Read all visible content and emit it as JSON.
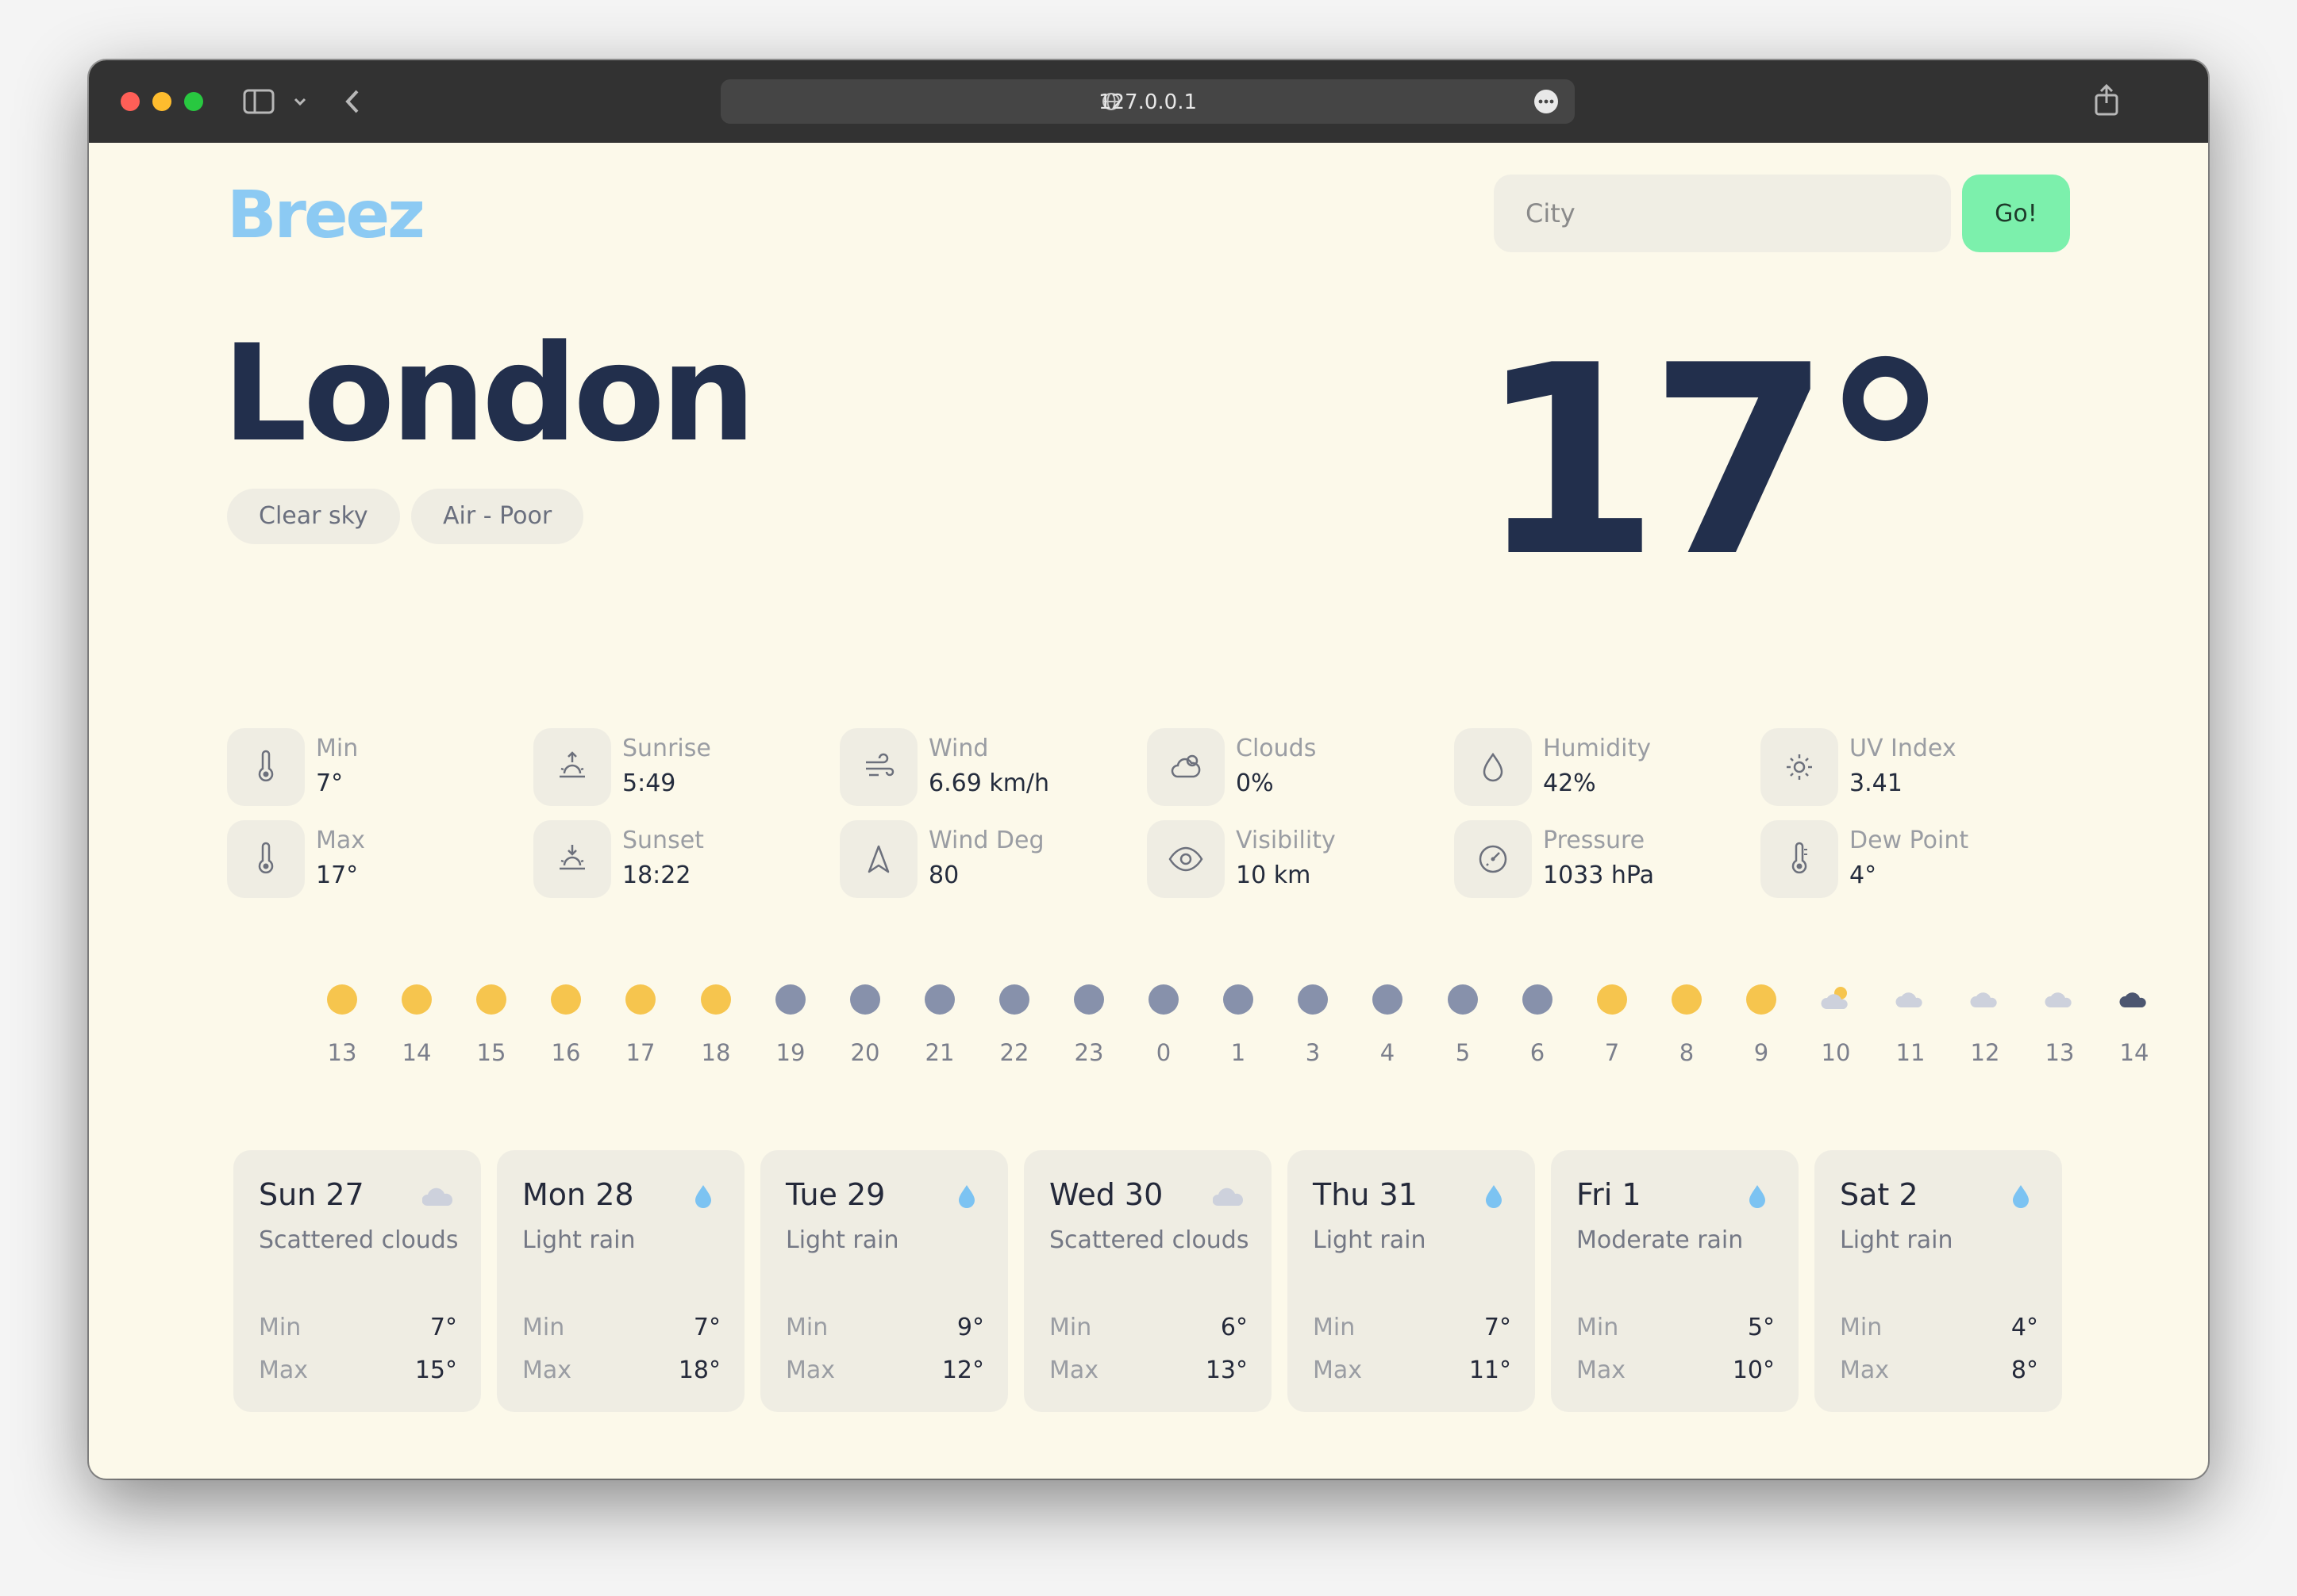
{
  "browser": {
    "url": "127.0.0.1"
  },
  "app": {
    "logo": "Breez"
  },
  "search": {
    "placeholder": "City",
    "button": "Go!"
  },
  "current": {
    "city": "London",
    "temp": "17°",
    "chips": [
      "Clear sky",
      "Air - Poor"
    ]
  },
  "stats": [
    {
      "label": "Min",
      "value": "7°",
      "icon": "thermometer-icon"
    },
    {
      "label": "Sunrise",
      "value": "5:49",
      "icon": "sunrise-icon"
    },
    {
      "label": "Wind",
      "value": "6.69 km/h",
      "icon": "wind-icon"
    },
    {
      "label": "Clouds",
      "value": "0%",
      "icon": "cloud-icon"
    },
    {
      "label": "Humidity",
      "value": "42%",
      "icon": "droplet-icon"
    },
    {
      "label": "UV Index",
      "value": "3.41",
      "icon": "sun-icon"
    },
    {
      "label": "Max",
      "value": "17°",
      "icon": "thermometer-icon"
    },
    {
      "label": "Sunset",
      "value": "18:22",
      "icon": "sunset-icon"
    },
    {
      "label": "Wind Deg",
      "value": "80",
      "icon": "navigation-arrow-icon"
    },
    {
      "label": "Visibility",
      "value": "10 km",
      "icon": "eye-icon"
    },
    {
      "label": "Pressure",
      "value": "1033 hPa",
      "icon": "gauge-icon"
    },
    {
      "label": "Dew Point",
      "value": "4°",
      "icon": "thermometer-icon"
    }
  ],
  "hourly": [
    {
      "hour": "13",
      "icon": "sun"
    },
    {
      "hour": "14",
      "icon": "sun"
    },
    {
      "hour": "15",
      "icon": "sun"
    },
    {
      "hour": "16",
      "icon": "sun"
    },
    {
      "hour": "17",
      "icon": "sun"
    },
    {
      "hour": "18",
      "icon": "sun"
    },
    {
      "hour": "19",
      "icon": "moon"
    },
    {
      "hour": "20",
      "icon": "moon"
    },
    {
      "hour": "21",
      "icon": "moon"
    },
    {
      "hour": "22",
      "icon": "moon"
    },
    {
      "hour": "23",
      "icon": "moon"
    },
    {
      "hour": "0",
      "icon": "moon"
    },
    {
      "hour": "1",
      "icon": "moon"
    },
    {
      "hour": "3",
      "icon": "moon"
    },
    {
      "hour": "4",
      "icon": "moon"
    },
    {
      "hour": "5",
      "icon": "moon"
    },
    {
      "hour": "6",
      "icon": "moon"
    },
    {
      "hour": "7",
      "icon": "sun"
    },
    {
      "hour": "8",
      "icon": "sun"
    },
    {
      "hour": "9",
      "icon": "sun"
    },
    {
      "hour": "10",
      "icon": "partly-cloudy"
    },
    {
      "hour": "11",
      "icon": "cloud"
    },
    {
      "hour": "12",
      "icon": "cloud"
    },
    {
      "hour": "13",
      "icon": "cloud"
    },
    {
      "hour": "14",
      "icon": "dark-cloud"
    }
  ],
  "daily": [
    {
      "day": "Sun 27",
      "desc": "Scattered clouds",
      "icon": "cloud",
      "min": "7°",
      "max": "15°"
    },
    {
      "day": "Mon 28",
      "desc": "Light rain",
      "icon": "rain-drop",
      "min": "7°",
      "max": "18°"
    },
    {
      "day": "Tue 29",
      "desc": "Light rain",
      "icon": "rain-drop",
      "min": "9°",
      "max": "12°"
    },
    {
      "day": "Wed 30",
      "desc": "Scattered clouds",
      "icon": "cloud",
      "min": "6°",
      "max": "13°"
    },
    {
      "day": "Thu 31",
      "desc": "Light rain",
      "icon": "rain-drop",
      "min": "7°",
      "max": "11°"
    },
    {
      "day": "Fri 1",
      "desc": "Moderate rain",
      "icon": "rain-drop",
      "min": "5°",
      "max": "10°"
    },
    {
      "day": "Sat 2",
      "desc": "Light rain",
      "icon": "rain-drop",
      "min": "4°",
      "max": "8°"
    }
  ],
  "labels": {
    "min": "Min",
    "max": "Max"
  },
  "colors": {
    "background": "#fcf9ea",
    "logo": "#8ccaf3",
    "go_button": "#7cf0ac",
    "sun": "#f6c54e",
    "moon": "#8791ab",
    "rain": "#7cc3f2",
    "text_dark": "#222f4c"
  }
}
